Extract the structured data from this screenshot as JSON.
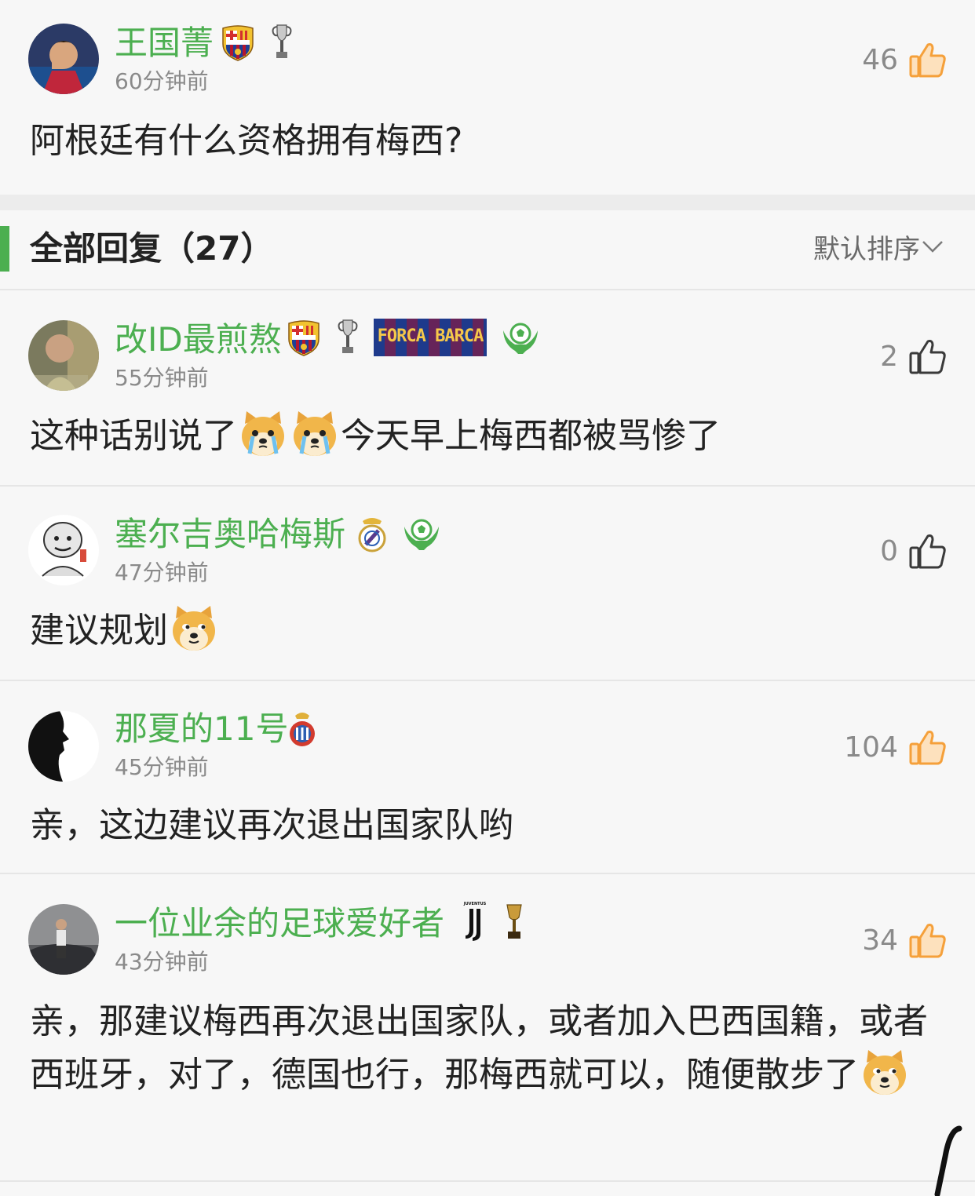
{
  "post": {
    "username": "王国菁",
    "time": "60分钟前",
    "likes": "46",
    "content": "阿根廷有什么资格拥有梅西?",
    "liked": true
  },
  "replies_header": {
    "title": "全部回复（27）",
    "sort_label": "默认排序"
  },
  "replies": [
    {
      "username": "改ID最煎熬",
      "time": "55分钟前",
      "likes": "2",
      "liked": false,
      "badge_text": "FORCA BARCA",
      "content_before": "这种话别说了",
      "content_after": "今天早上梅西都被骂惨了"
    },
    {
      "username": "塞尔吉奥哈梅斯",
      "time": "47分钟前",
      "likes": "0",
      "liked": false,
      "content": "建议规划"
    },
    {
      "username": "那夏的11号",
      "time": "45分钟前",
      "likes": "104",
      "liked": true,
      "content": "亲，这边建议再次退出国家队哟"
    },
    {
      "username": "一位业余的足球爱好者",
      "time": "43分钟前",
      "likes": "34",
      "liked": true,
      "badge_text": "JUVENTUS",
      "content": "亲，那建议梅西再次退出国家队，或者加入巴西国籍，或者西班牙，对了，德国也行，那梅西就可以，随便散步了"
    }
  ],
  "colors": {
    "username_green": "#4caf50",
    "liked_orange": "#f5a03a",
    "gray_text": "#8a8a8a"
  },
  "icons": {
    "like": "thumbs-up-icon",
    "sort": "chevron-down-icon",
    "emoji": "doge-emoji-icon"
  }
}
